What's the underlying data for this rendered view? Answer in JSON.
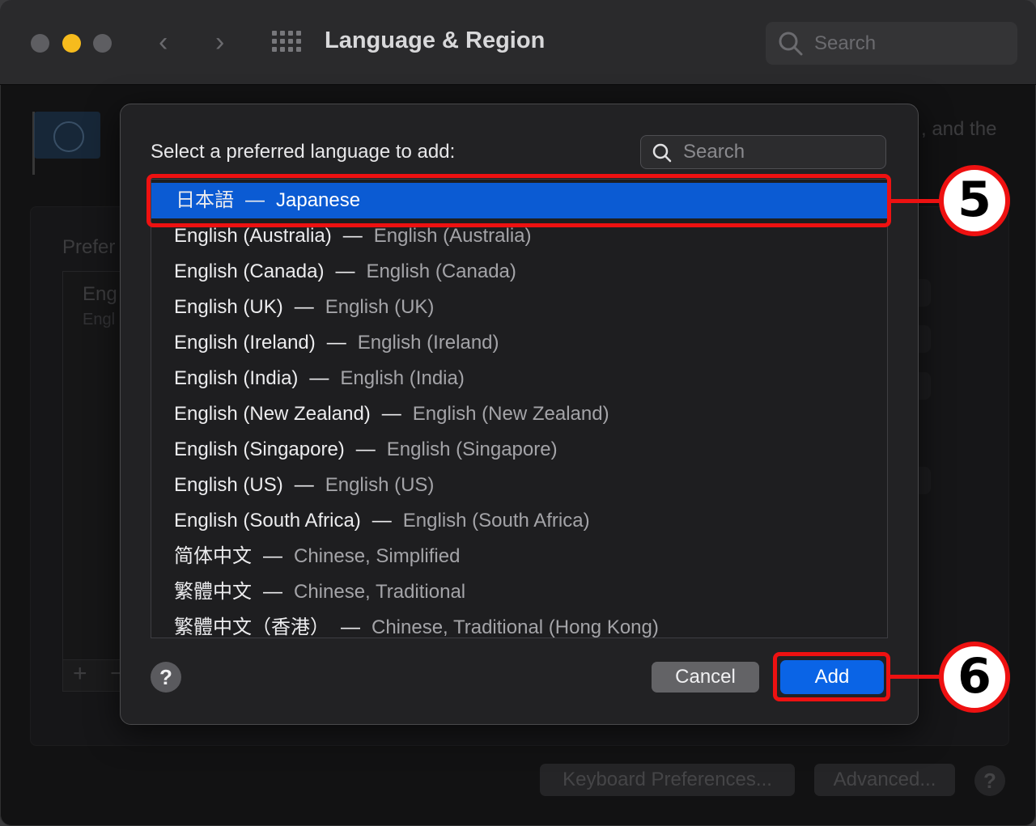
{
  "window": {
    "title": "Language & Region",
    "search_placeholder": "Search",
    "nav_back_icon": "chevron-left-icon",
    "nav_forward_icon": "chevron-right-icon",
    "grid_icon": "show-all-grid-icon"
  },
  "background": {
    "desc_fragment": ", and the",
    "preferred_label_fragment": "Prefer",
    "list_item_primary": "Eng",
    "list_item_secondary": "Engl",
    "plus_label": "+",
    "minus_label": "−",
    "keyboard_button": "Keyboard Preferences...",
    "advanced_button": "Advanced...",
    "help_label": "?"
  },
  "dialog": {
    "prompt": "Select a preferred language to add:",
    "search_placeholder": "Search",
    "selected_index": 0,
    "languages": [
      {
        "native": "日本語",
        "english": "Japanese"
      },
      {
        "native": "English (Australia)",
        "english": "English (Australia)"
      },
      {
        "native": "English (Canada)",
        "english": "English (Canada)"
      },
      {
        "native": "English (UK)",
        "english": "English (UK)"
      },
      {
        "native": "English (Ireland)",
        "english": "English (Ireland)"
      },
      {
        "native": "English (India)",
        "english": "English (India)"
      },
      {
        "native": "English (New Zealand)",
        "english": "English (New Zealand)"
      },
      {
        "native": "English (Singapore)",
        "english": "English (Singapore)"
      },
      {
        "native": "English (US)",
        "english": "English (US)"
      },
      {
        "native": "English (South Africa)",
        "english": "English (South Africa)"
      },
      {
        "native": "简体中文",
        "english": "Chinese, Simplified"
      },
      {
        "native": "繁體中文",
        "english": "Chinese, Traditional"
      },
      {
        "native": "繁體中文（香港）",
        "english": "Chinese, Traditional (Hong Kong)"
      }
    ],
    "dash": "—",
    "help_label": "?",
    "cancel_label": "Cancel",
    "add_label": "Add"
  },
  "annotations": {
    "step5": "5",
    "step6": "6",
    "highlight_color": "#ee1111"
  },
  "colors": {
    "selection": "#0b5bd3",
    "add_button": "#0a64e6"
  }
}
